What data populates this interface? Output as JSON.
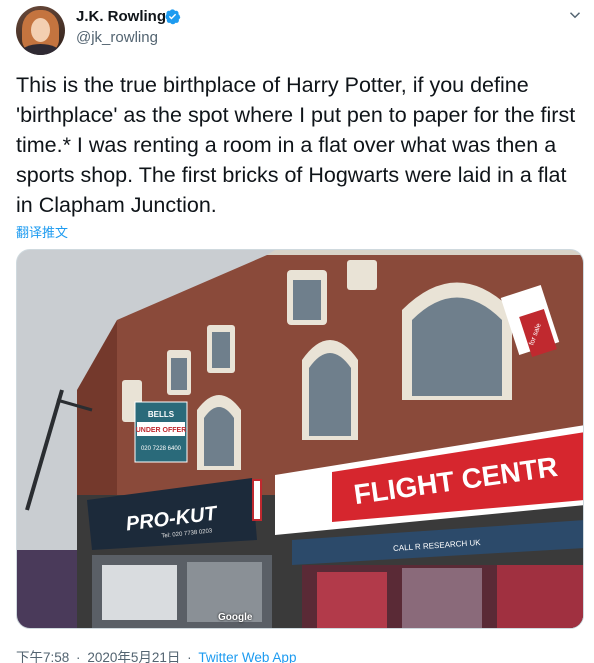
{
  "author": {
    "name": "J.K. Rowling",
    "handle": "@jk_rowling",
    "verified": true
  },
  "tweet": {
    "text": "This is the true birthplace of Harry Potter, if you define 'birthplace' as the spot where I put pen to paper for the first time.* I was renting a room in a flat over what was then a sports shop. The first bricks of Hogwarts were laid in a flat in Clapham Junction.",
    "translate_label": "翻译推文"
  },
  "photo": {
    "signs": {
      "bells_agent": "BELLS",
      "under_offer": "UNDER OFFER",
      "bells_phone": "020 7228 6400",
      "prokut": "PRO-KUT",
      "prokut_phone": "Tel: 020 7738 0203",
      "flight_centre": "FLIGHT CENTR",
      "research_strip": "CALL R RESEARCH UK",
      "for_sale": "for sale",
      "watermark": "Google"
    }
  },
  "meta": {
    "time": "下午7:58",
    "date": "2020年5月21日",
    "separator": "·",
    "source": "Twitter Web App"
  },
  "colors": {
    "link": "#1d9bf0",
    "muted": "#536471",
    "verified": "#1d9bf0"
  },
  "icons": {
    "verified": "verified-badge-icon",
    "more": "chevron-down-icon"
  }
}
